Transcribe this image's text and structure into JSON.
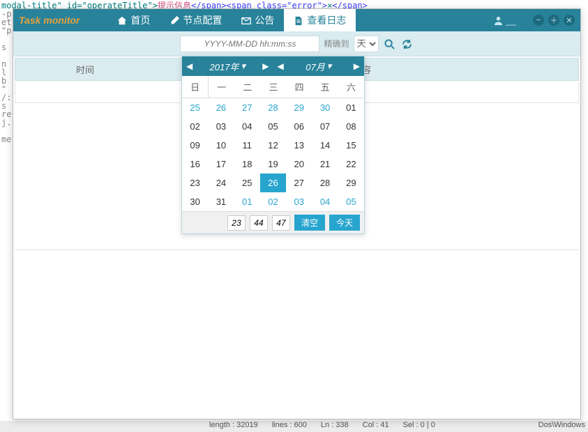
{
  "bg": {
    "line1_pre": "modal-title\" id=\"operateTitle\">",
    "line1_str": "提示信息",
    "line1_mid": "</span><span class=\"error\">",
    "line1_end": "</span>",
    "frag_chars": [
      "-p",
      "et:",
      "\"p",
      "",
      "s",
      "",
      "n",
      "l",
      "b",
      "\"",
      "/:",
      "s",
      "re",
      "j.",
      "",
      "me"
    ]
  },
  "status": {
    "length": "length : 32019",
    "lines": "lines : 600",
    "ln": "Ln : 338",
    "col": "Col : 41",
    "sel": "Sel : 0 | 0",
    "enc": "Dos\\Windows"
  },
  "app": {
    "title": "Task monitor"
  },
  "nav": {
    "home": "首页",
    "config": "节点配置",
    "notice": "公告",
    "logs": "查看日志"
  },
  "toolbar": {
    "placeholder": "YYYY-MM-DD hh:mm:ss",
    "precision_label": "精确到",
    "precision_value": "天"
  },
  "table": {
    "time_col": "时间",
    "content_col": "容"
  },
  "calendar": {
    "year": "2017年",
    "month": "07月",
    "dow": [
      "日",
      "一",
      "二",
      "三",
      "四",
      "五",
      "六"
    ],
    "weeks": [
      [
        {
          "d": "25",
          "o": true
        },
        {
          "d": "26",
          "o": true
        },
        {
          "d": "27",
          "o": true
        },
        {
          "d": "28",
          "o": true
        },
        {
          "d": "29",
          "o": true
        },
        {
          "d": "30",
          "o": true
        },
        {
          "d": "01"
        }
      ],
      [
        {
          "d": "02"
        },
        {
          "d": "03"
        },
        {
          "d": "04"
        },
        {
          "d": "05"
        },
        {
          "d": "06"
        },
        {
          "d": "07"
        },
        {
          "d": "08"
        }
      ],
      [
        {
          "d": "09"
        },
        {
          "d": "10"
        },
        {
          "d": "11"
        },
        {
          "d": "12"
        },
        {
          "d": "13"
        },
        {
          "d": "14"
        },
        {
          "d": "15"
        }
      ],
      [
        {
          "d": "16"
        },
        {
          "d": "17"
        },
        {
          "d": "18"
        },
        {
          "d": "19"
        },
        {
          "d": "20"
        },
        {
          "d": "21"
        },
        {
          "d": "22"
        }
      ],
      [
        {
          "d": "23"
        },
        {
          "d": "24"
        },
        {
          "d": "25"
        },
        {
          "d": "26",
          "sel": true
        },
        {
          "d": "27"
        },
        {
          "d": "28"
        },
        {
          "d": "29"
        }
      ],
      [
        {
          "d": "30"
        },
        {
          "d": "31"
        },
        {
          "d": "01",
          "o": true
        },
        {
          "d": "02",
          "o": true
        },
        {
          "d": "03",
          "o": true
        },
        {
          "d": "04",
          "o": true
        },
        {
          "d": "05",
          "o": true
        }
      ]
    ],
    "time": {
      "h": "23",
      "m": "44",
      "s": "47"
    },
    "clear": "清空",
    "today": "今天"
  }
}
